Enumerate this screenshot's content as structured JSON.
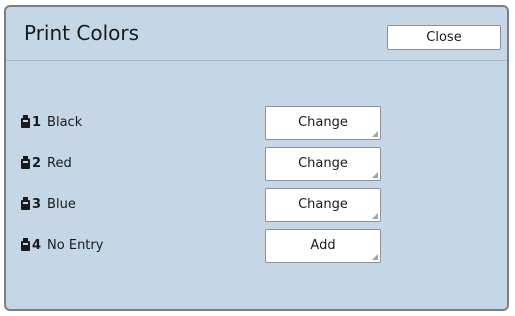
{
  "header": {
    "title": "Print Colors",
    "close_label": "Close"
  },
  "rows": [
    {
      "number": "1",
      "name": "Black",
      "button": "Change"
    },
    {
      "number": "2",
      "name": "Red",
      "button": "Change"
    },
    {
      "number": "3",
      "name": "Blue",
      "button": "Change"
    },
    {
      "number": "4",
      "name": "No Entry",
      "button": "Add"
    }
  ],
  "icons": {
    "ink_slot": "ink-cartridge-icon"
  },
  "colors": {
    "panel_background": "#c5d6e6",
    "frame_border": "#7a7f86",
    "button_background": "#ffffff"
  }
}
